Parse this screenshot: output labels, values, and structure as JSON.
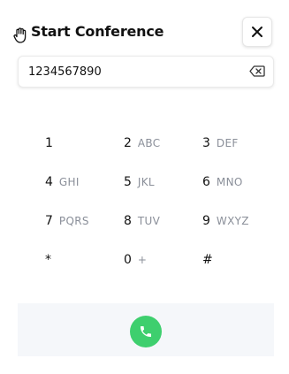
{
  "header": {
    "title": "Start Conference",
    "drag_icon": "hand-grab-icon",
    "close_icon": "close-icon"
  },
  "number_field": {
    "value": "1234567890",
    "backspace_icon": "backspace-icon"
  },
  "keypad": [
    {
      "digit": "1",
      "letters": ""
    },
    {
      "digit": "2",
      "letters": "ABC"
    },
    {
      "digit": "3",
      "letters": "DEF"
    },
    {
      "digit": "4",
      "letters": "GHI"
    },
    {
      "digit": "5",
      "letters": "JKL"
    },
    {
      "digit": "6",
      "letters": "MNO"
    },
    {
      "digit": "7",
      "letters": "PQRS"
    },
    {
      "digit": "8",
      "letters": "TUV"
    },
    {
      "digit": "9",
      "letters": "WXYZ"
    },
    {
      "digit": "*",
      "letters": ""
    },
    {
      "digit": "0",
      "letters": "+"
    },
    {
      "digit": "#",
      "letters": ""
    }
  ],
  "call": {
    "icon": "phone-icon",
    "accent": "#3ecf6e"
  }
}
